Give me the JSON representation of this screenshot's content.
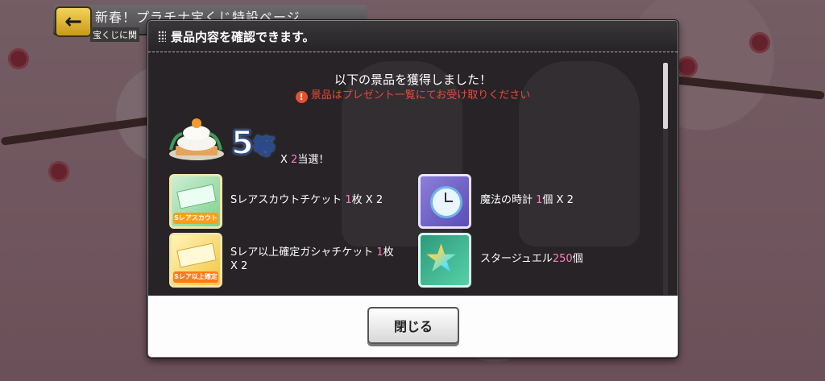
{
  "header": {
    "title": "新春！プラチナ宝くじ特設ページ",
    "subtitle": "宝くじに関"
  },
  "modal": {
    "title": "景品内容を確認できます。",
    "acquired_message": "以下の景品を獲得しました！",
    "notice": "景品はプレゼント一覧にてお受け取りください",
    "notice_icon": "!",
    "prize_rank": {
      "number": "5",
      "suffix": "等",
      "count_prefix": "X ",
      "count": "2",
      "count_suffix": "当選！"
    },
    "items": [
      {
        "name": "Sレアスカウトチケット ",
        "qty": "1",
        "qty_suffix": "枚 X 2",
        "icon": "scout-ticket-icon",
        "icon_tag": "Sレアスカウト"
      },
      {
        "name": "魔法の時計 ",
        "qty": "1",
        "qty_suffix": "個 X 2",
        "icon": "magic-clock-icon"
      },
      {
        "name": "Sレア以上確定ガシャチケット ",
        "qty": "1",
        "qty_suffix": "枚 X 2",
        "icon": "gacha-ticket-icon",
        "icon_tag": "Sレア以上確定"
      },
      {
        "name": "スタージュエル",
        "qty": "250",
        "qty_suffix": "個",
        "icon": "star-jewel-icon"
      }
    ],
    "close_label": "閉じる"
  },
  "colors": {
    "accent_pink": "#ff7fc2",
    "notice_red": "#e84b3b"
  }
}
